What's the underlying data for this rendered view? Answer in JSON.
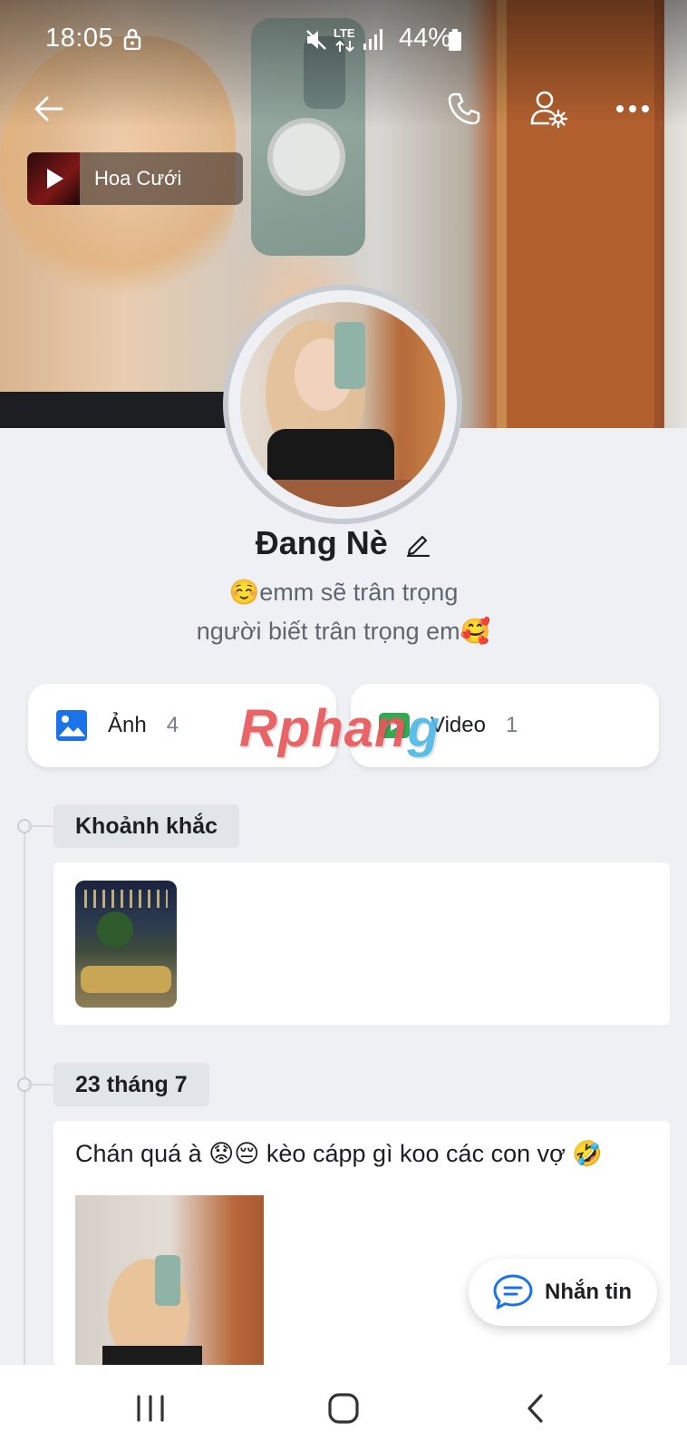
{
  "status_bar": {
    "time": "18:05",
    "network": "LTE",
    "battery": "44%"
  },
  "music": {
    "title": "Hoa Cưới"
  },
  "profile": {
    "name": "Đang Nè",
    "bio_line1": "☺️emm sẽ trân trọng",
    "bio_line2": "người biết trân trọng em🥰"
  },
  "media": {
    "photos_label": "Ảnh",
    "photos_count": "4",
    "videos_label": "Video",
    "videos_count": "1"
  },
  "watermark": {
    "text_main": "Rphan",
    "text_tail": "g"
  },
  "timeline": [
    {
      "heading": "Khoảnh khắc"
    },
    {
      "heading": "23 tháng 7",
      "post_text": "Chán quá à 😟😔 kèo cápp gì koo các con vợ 🤣"
    }
  ],
  "chat_button": {
    "label": "Nhắn tin"
  },
  "icons": {
    "back": "arrow-left",
    "call": "phone",
    "settings": "user-gear",
    "more": "ellipsis",
    "edit": "pencil",
    "photos": "image",
    "videos": "video",
    "chat": "chat-bubble"
  },
  "colors": {
    "background": "#eef0f3",
    "photo_icon": "#1a73e8",
    "video_icon": "#34a853",
    "chat_icon": "#1a73e8",
    "watermark_red": "#e8575b",
    "watermark_blue": "#4fb9e6"
  }
}
